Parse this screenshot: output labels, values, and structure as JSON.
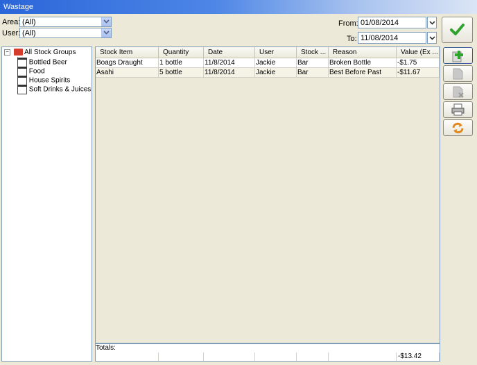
{
  "window": {
    "title": "Wastage"
  },
  "filters": {
    "area_label": "Area:",
    "area_value": "(All)",
    "user_label": "User:",
    "user_value": "(All)",
    "from_label": "From:",
    "from_value": "01/08/2014",
    "to_label": "To:",
    "to_value": "11/08/2014"
  },
  "tree": {
    "root": "All Stock Groups",
    "items": [
      "Bottled Beer",
      "Food",
      "House Spirits",
      "Soft Drinks & Juices"
    ]
  },
  "table": {
    "columns": [
      "Stock Item",
      "Quantity",
      "Date",
      "User",
      "Stock ...",
      "Reason",
      "Value (Ex ..."
    ],
    "rows": [
      [
        "Boags Draught",
        "1 bottle",
        "11/8/2014",
        "Jackie",
        "Bar",
        "Broken Bottle",
        "-$1.75"
      ],
      [
        "Asahi",
        "5 bottle",
        "11/8/2014",
        "Jackie",
        "Bar",
        "Best Before Past",
        "-$11.67"
      ]
    ],
    "totals_label": "Totals:",
    "total_value": "-$13.42"
  },
  "toolbar": {
    "icons": [
      "checkmark-icon",
      "add-icon",
      "edit-icon",
      "delete-icon",
      "print-icon",
      "refresh-icon"
    ]
  },
  "colors": {
    "accent": "#2b66d9",
    "ok_green": "#2ea32e",
    "selected_row": "#f5f3e6"
  }
}
